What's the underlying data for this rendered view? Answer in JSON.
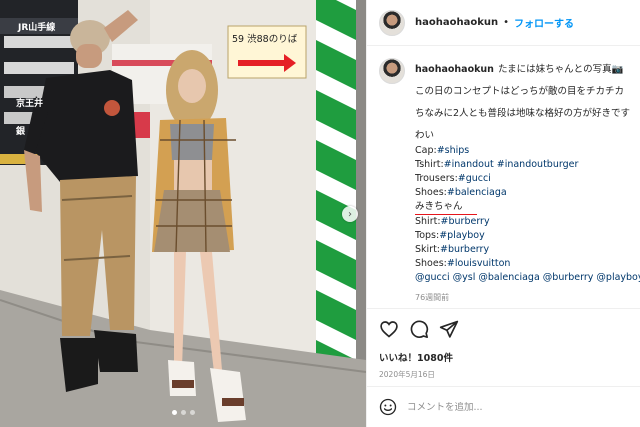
{
  "post": {
    "username": "haohaohaokun",
    "separator": "•",
    "follow_label": "フォローする"
  },
  "photo": {
    "platform_number_sign": "59 渋88のりば",
    "station_sign_1": "JR山手線",
    "station_sign_2": "京王井",
    "station_sign_3": "銀"
  },
  "caption": {
    "username": "haohaohaokun",
    "first_line": "たまには妹ちゃんとの写真📷",
    "line_concept": "この日のコンセプトはどっちが敵の目をチカチカ",
    "line_note": "ちなみに2人とも普段は地味な格好の方が好きです",
    "him_label": "わい",
    "him_items": [
      {
        "label": "Cap:",
        "tags": "#ships"
      },
      {
        "label": "Tshirt:",
        "tags": "#inandout #inandoutburger"
      },
      {
        "label": "Trousers:",
        "tags": "#gucci"
      },
      {
        "label": "Shoes:",
        "tags": "#balenciaga"
      }
    ],
    "her_label": "みきちゃん",
    "her_items": [
      {
        "label": "Shirt:",
        "tags": "#burberry"
      },
      {
        "label": "Tops:",
        "tags": "#playboy"
      },
      {
        "label": "Skirt:",
        "tags": "#burberry"
      },
      {
        "label": "Shoes:",
        "tags": "#louisvuitton"
      }
    ],
    "mentions": "@gucci @ysl @balenciaga @burberry @playboy",
    "time_ago": "76週間前"
  },
  "actions": {
    "likes": "いいね！1080件",
    "date": "2020年5月16日"
  },
  "comment": {
    "placeholder": "コメントを追加..."
  },
  "icons": [
    "heart-icon",
    "comment-icon",
    "share-icon",
    "smile-icon",
    "chevron-right-icon"
  ],
  "colors": {
    "link": "#00376b",
    "follow": "#0095f6",
    "underline": "#e5151b"
  }
}
